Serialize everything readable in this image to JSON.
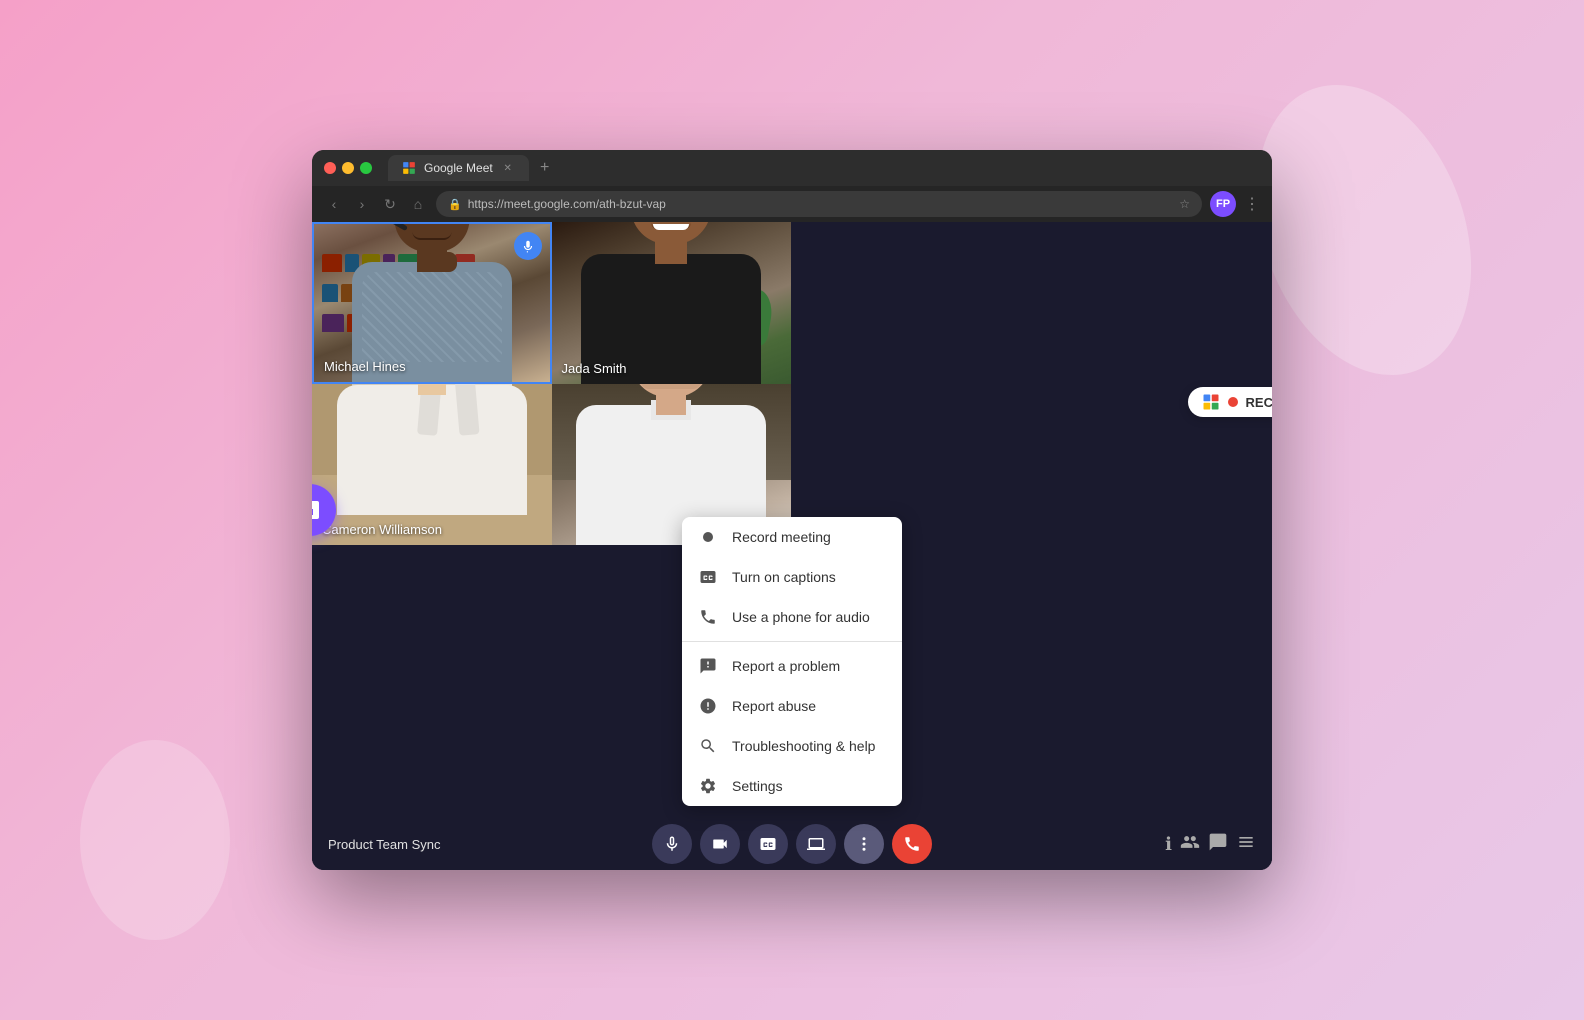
{
  "background": {
    "color": "#f0b0d0"
  },
  "browser": {
    "title": "Google Meet",
    "url": "https://meet.google.com/ath-bzut-vap",
    "tab_label": "Google Meet",
    "close_label": "×"
  },
  "meeting": {
    "name": "Product Team Sync",
    "participants": [
      {
        "id": "michael",
        "name": "Michael Hines",
        "active": true,
        "tile": 1
      },
      {
        "id": "jada",
        "name": "Jada Smith",
        "active": false,
        "tile": 2
      },
      {
        "id": "cameron",
        "name": "Cameron Williamson",
        "active": false,
        "tile": 3
      },
      {
        "id": "man",
        "name": "",
        "active": false,
        "tile": 4
      }
    ]
  },
  "rec_badge": {
    "text": "REC"
  },
  "context_menu": {
    "items": [
      {
        "id": "record",
        "label": "Record meeting",
        "icon": "record-icon"
      },
      {
        "id": "captions",
        "label": "Turn on captions",
        "icon": "captions-icon"
      },
      {
        "id": "phone",
        "label": "Use a phone for audio",
        "icon": "phone-icon"
      },
      {
        "id": "report-problem",
        "label": "Report a problem",
        "icon": "report-problem-icon"
      },
      {
        "id": "report-abuse",
        "label": "Report abuse",
        "icon": "report-abuse-icon"
      },
      {
        "id": "troubleshooting",
        "label": "Troubleshooting & help",
        "icon": "troubleshoot-icon"
      },
      {
        "id": "settings",
        "label": "Settings",
        "icon": "settings-icon"
      }
    ]
  },
  "toolbar": {
    "mic_label": "Microphone",
    "camera_label": "Camera",
    "captions_label": "Captions",
    "present_label": "Present",
    "more_label": "More options",
    "end_label": "End call",
    "info_label": "Meeting info",
    "people_label": "People",
    "chat_label": "Chat",
    "activities_label": "Activities"
  }
}
